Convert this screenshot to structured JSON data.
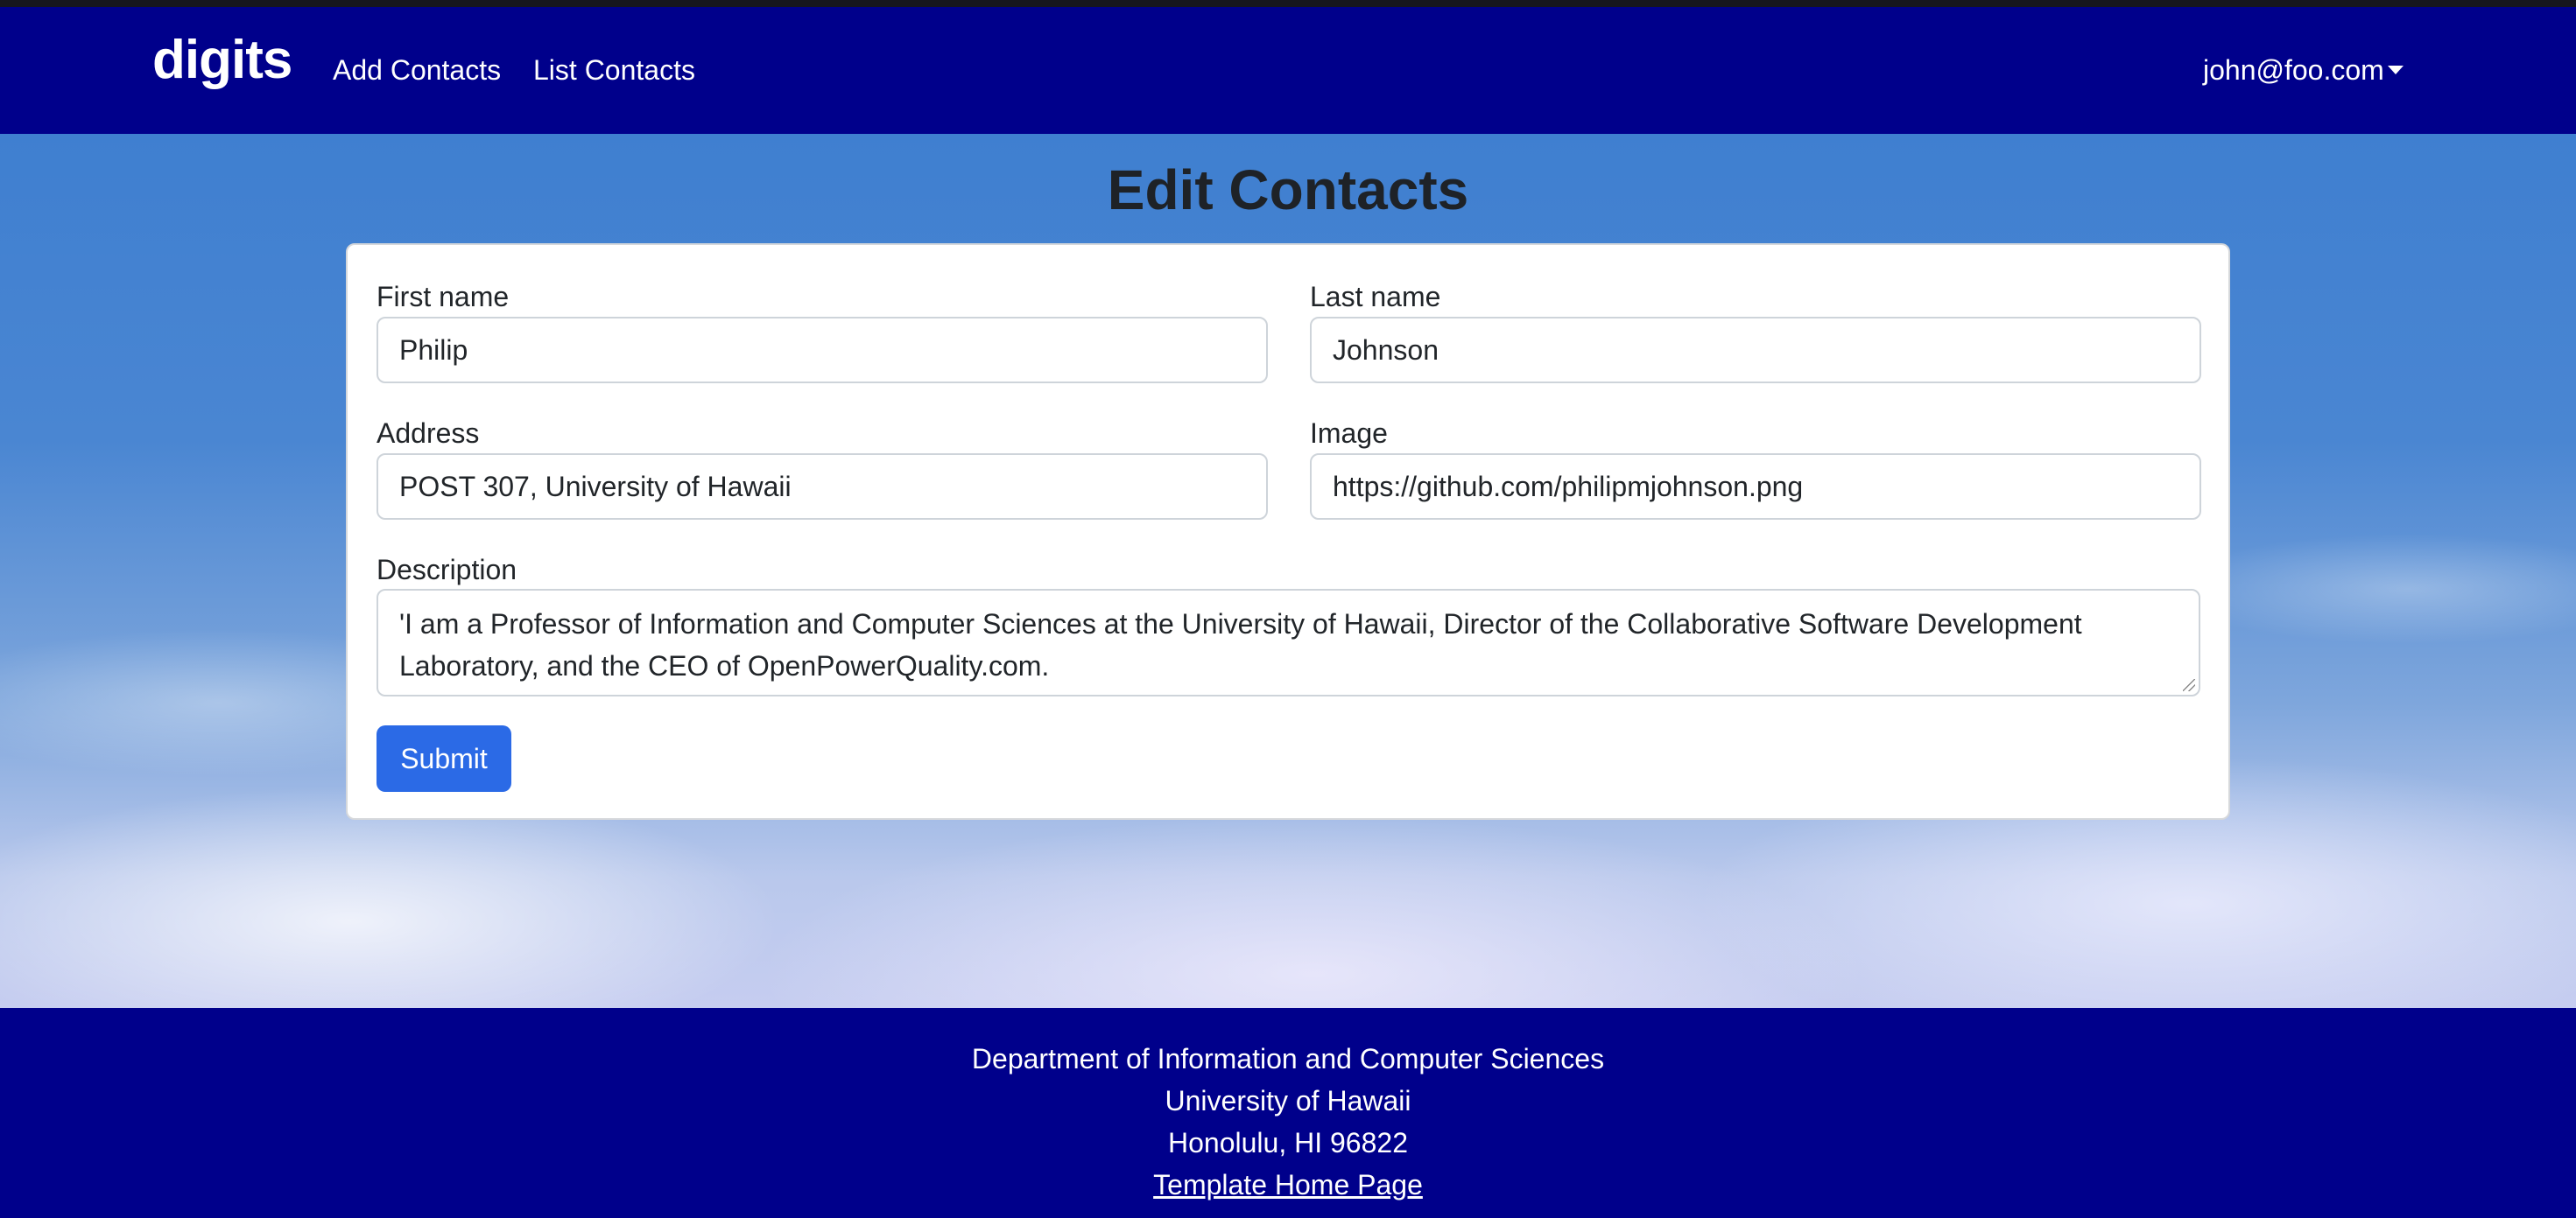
{
  "navbar": {
    "brand": "digits",
    "links": [
      {
        "label": "Add Contacts"
      },
      {
        "label": "List Contacts"
      }
    ],
    "user_email": "john@foo.com"
  },
  "page": {
    "title": "Edit Contacts"
  },
  "form": {
    "first_name": {
      "label": "First name",
      "value": "Philip"
    },
    "last_name": {
      "label": "Last name",
      "value": "Johnson"
    },
    "address": {
      "label": "Address",
      "value": "POST 307, University of Hawaii"
    },
    "image": {
      "label": "Image",
      "value": "https://github.com/philipmjohnson.png"
    },
    "description": {
      "label": "Description",
      "value": "'I am a Professor of Information and Computer Sciences at the University of Hawaii, Director of the Collaborative Software Development Laboratory, and the CEO of OpenPowerQuality.com."
    },
    "submit_label": "Submit"
  },
  "footer": {
    "lines": [
      "Department of Information and Computer Sciences",
      "University of Hawaii",
      "Honolulu, HI 96822"
    ],
    "link_label": "Template Home Page"
  },
  "colors": {
    "navbar": "#00008b",
    "primary_button": "#2b6ae6"
  }
}
